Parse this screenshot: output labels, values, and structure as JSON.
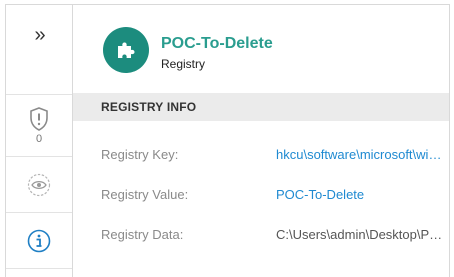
{
  "rail": {
    "expand_glyph": "»",
    "threat_count": "0",
    "items": [
      {
        "icon": "expand-chevrons-icon"
      },
      {
        "icon": "shield-alert-icon"
      },
      {
        "icon": "eye-watch-icon"
      },
      {
        "icon": "info-icon"
      }
    ]
  },
  "header": {
    "icon": "puzzle-piece-icon",
    "title": "POC-To-Delete",
    "subtitle": "Registry"
  },
  "section": {
    "title": "REGISTRY INFO"
  },
  "fields": [
    {
      "label": "Registry Key:",
      "value": "hkcu\\software\\microsoft\\windows\\currentversion\\run",
      "style": "link"
    },
    {
      "label": "Registry Value:",
      "value": "POC-To-Delete",
      "style": "link"
    },
    {
      "label": "Registry Data:",
      "value": "C:\\Users\\admin\\Desktop\\POC-To-Delete.exe",
      "style": "plain"
    }
  ],
  "colors": {
    "accent": "#1c8c7e",
    "title": "#2a9d8f",
    "link": "#1f8ad1",
    "info_icon": "#1f7fc4"
  }
}
